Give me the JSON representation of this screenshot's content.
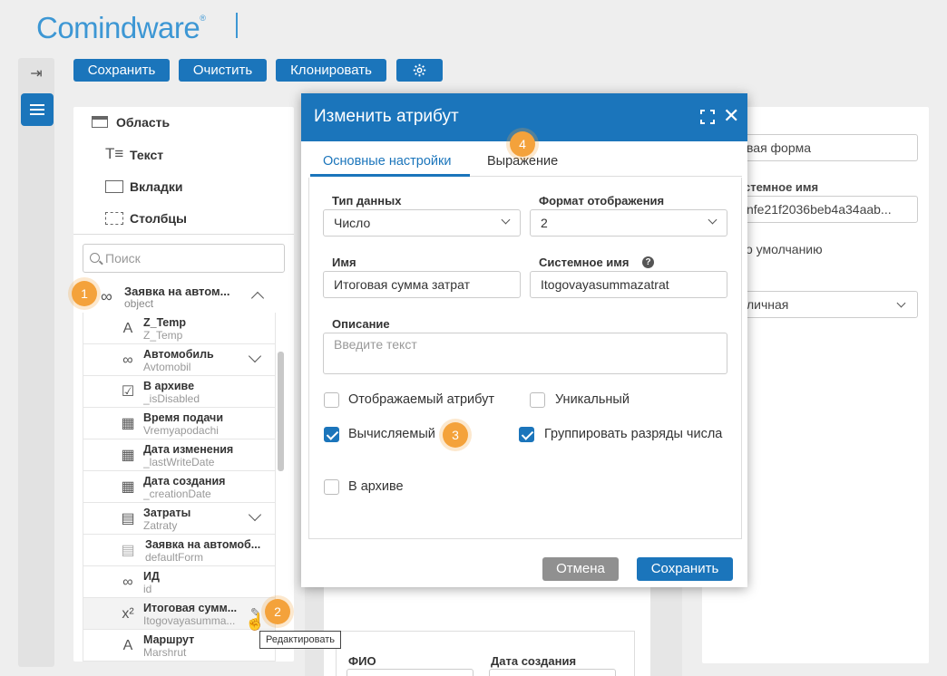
{
  "brand": {
    "logo_text": "Comindware",
    "logo_mark": "®"
  },
  "toolbar": {
    "save": "Сохранить",
    "clear": "Очистить",
    "clone": "Клонировать",
    "settings_icon": "gear-icon"
  },
  "left_panel": {
    "controls": [
      {
        "label": "Область",
        "icon": "area-icon"
      },
      {
        "label": "Текст",
        "icon": "text-icon"
      },
      {
        "label": "Вкладки",
        "icon": "tabs-icon"
      },
      {
        "label": "Столбцы",
        "icon": "columns-icon"
      }
    ],
    "search_placeholder": "Поиск",
    "root": {
      "title": "Заявка на автом...",
      "subtitle": "object"
    },
    "items": [
      {
        "title": "Z_Temp",
        "subtitle": "Z_Temp",
        "icon": "A"
      },
      {
        "title": "Автомобиль",
        "subtitle": "Avtomobil",
        "icon": "∞"
      },
      {
        "title": "В архиве",
        "subtitle": "_isDisabled",
        "icon": "☑"
      },
      {
        "title": "Время подачи",
        "subtitle": "Vremyapodachi",
        "icon": "▦"
      },
      {
        "title": "Дата изменения",
        "subtitle": "_lastWriteDate",
        "icon": "▦"
      },
      {
        "title": "Дата создания",
        "subtitle": "_creationDate",
        "icon": "▦"
      },
      {
        "title": "Затраты",
        "subtitle": "Zatraty",
        "icon": "▤"
      },
      {
        "title": "Заявка на автомоб...",
        "subtitle": "defaultForm",
        "icon": "▤"
      },
      {
        "title": "ИД",
        "subtitle": "id",
        "icon": "∞"
      },
      {
        "title": "Итоговая сумм...",
        "subtitle": "Itogovayasumma...",
        "icon": "x²"
      },
      {
        "title": "Маршрут",
        "subtitle": "Marshrut",
        "icon": "A"
      }
    ],
    "tooltip": "Редактировать"
  },
  "badges": [
    "1",
    "2",
    "3",
    "4"
  ],
  "background_form": {
    "fio_label": "ФИО",
    "created_label": "Дата создания"
  },
  "right_panel": {
    "form_name_value": "вая форма",
    "sys_name_label": "стемное имя",
    "sys_name_value": "nfe21f2036beb4a34aab...",
    "default_label": "о умолчанию",
    "select_value": "личная"
  },
  "modal": {
    "title": "Изменить атрибут",
    "tabs": [
      "Основные настройки",
      "Выражение"
    ],
    "data_type_label": "Тип данных",
    "data_type_value": "Число",
    "display_format_label": "Формат отображения",
    "display_format_value": "2",
    "name_label": "Имя",
    "name_value": "Итоговая сумма затрат",
    "system_name_label": "Системное имя",
    "system_name_value": "Itogovayasummazatrat",
    "description_label": "Описание",
    "description_placeholder": "Введите текст",
    "checkboxes": {
      "displayed": {
        "label": "Отображаемый атрибут",
        "checked": false
      },
      "unique": {
        "label": "Уникальный",
        "checked": false
      },
      "calculated": {
        "label": "Вычисляемый",
        "checked": true
      },
      "group_digits": {
        "label": "Группировать разряды числа",
        "checked": true
      },
      "archive": {
        "label": "В архиве",
        "checked": false
      }
    },
    "cancel": "Отмена",
    "save": "Сохранить"
  },
  "colors": {
    "primary": "#1b75bb",
    "badge": "#f4a23b",
    "cancel": "#909090"
  }
}
